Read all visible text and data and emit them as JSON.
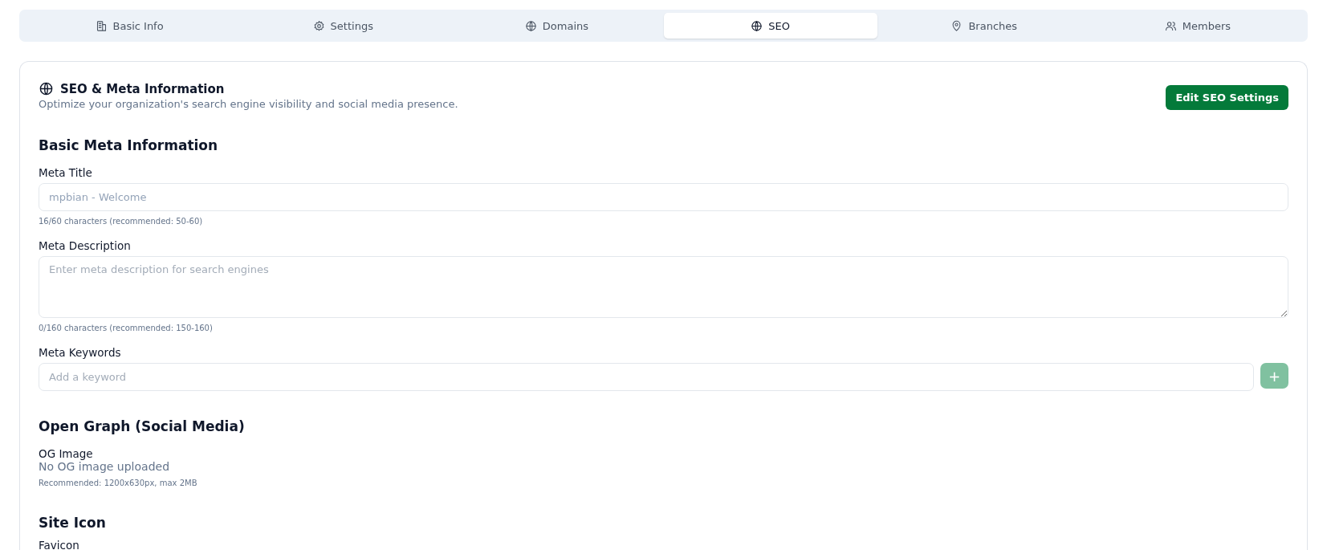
{
  "tabs": [
    {
      "label": "Basic Info",
      "selected": false
    },
    {
      "label": "Settings",
      "selected": false
    },
    {
      "label": "Domains",
      "selected": false
    },
    {
      "label": "SEO",
      "selected": true
    },
    {
      "label": "Branches",
      "selected": false
    },
    {
      "label": "Members",
      "selected": false
    }
  ],
  "card": {
    "title": "SEO & Meta Information",
    "subtitle": "Optimize your organization's search engine visibility and social media presence.",
    "edit_button": "Edit SEO Settings",
    "sections": [
      {
        "heading": "Basic Meta Information",
        "fields": [
          {
            "kind": "input",
            "label": "Meta Title",
            "value": "mpbian - Welcome",
            "hint": "16/60 characters (recommended: 50-60)"
          },
          {
            "kind": "textarea",
            "label": "Meta Description",
            "placeholder": "Enter meta description for search engines",
            "hint": "0/160 characters (recommended: 150-160)"
          },
          {
            "kind": "keywords",
            "label": "Meta Keywords",
            "placeholder": "Add a keyword",
            "add_button": "+",
            "add_disabled": true
          }
        ]
      },
      {
        "heading": "Open Graph (Social Media)",
        "fields": [
          {
            "kind": "upload",
            "label": "OG Image",
            "status": "No OG image uploaded",
            "hint": "Recommended: 1200x630px, max 2MB"
          }
        ]
      },
      {
        "heading": "Site Icon",
        "fields": [
          {
            "kind": "label",
            "label": "Favicon"
          }
        ]
      }
    ]
  }
}
